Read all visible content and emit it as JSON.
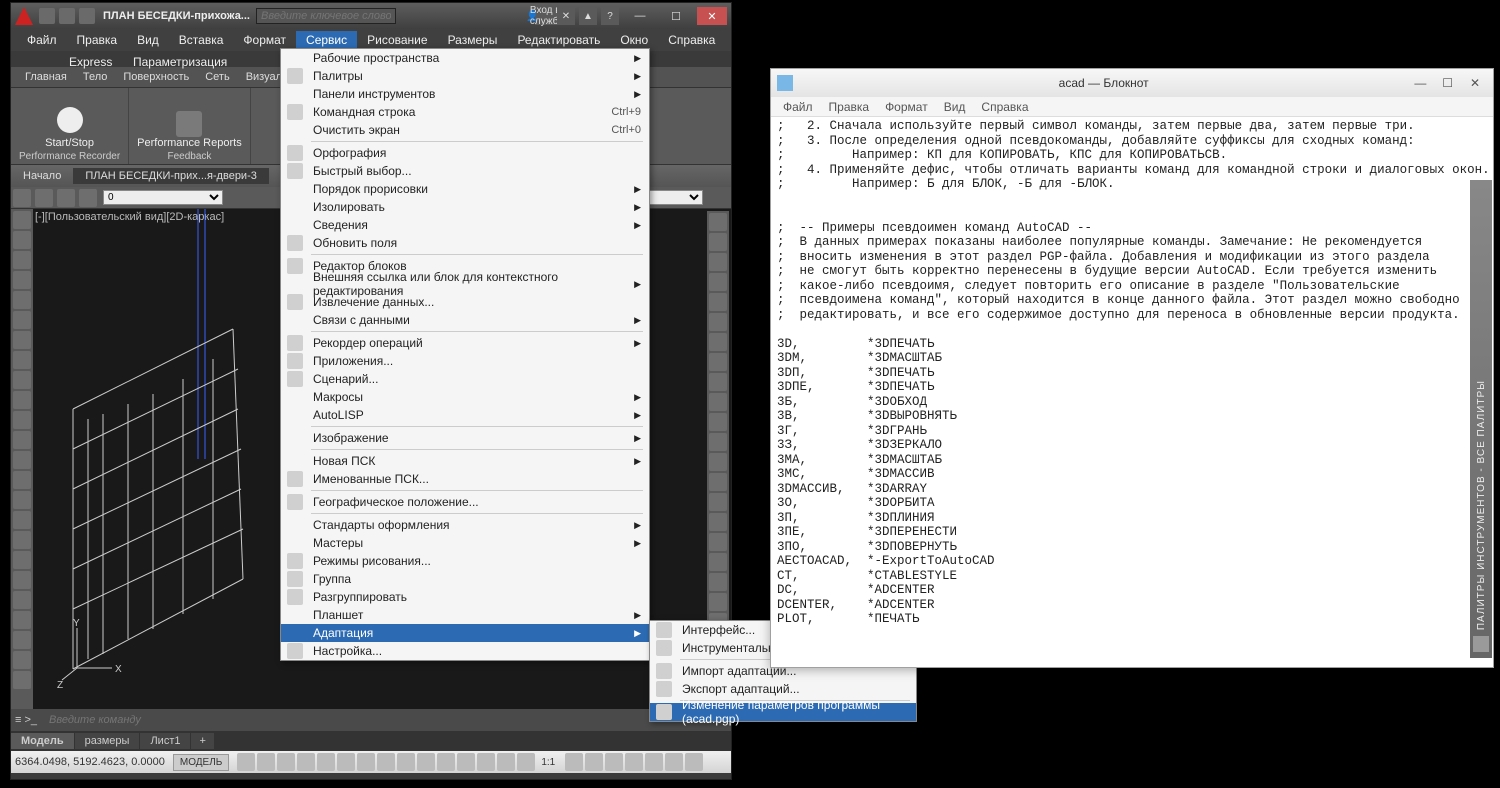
{
  "acad": {
    "doc_title": "ПЛАН БЕСЕДКИ-прихожа...",
    "search_placeholder": "Введите ключевое слово/фразу",
    "login_label": "Вход в службы",
    "menu": [
      "Файл",
      "Правка",
      "Вид",
      "Вставка",
      "Формат",
      "Сервис",
      "Рисование",
      "Размеры",
      "Редактировать",
      "Окно",
      "Справка"
    ],
    "menu_active": "Сервис",
    "express": "Express",
    "param": "Параметризация",
    "ribbon_tabs": [
      "Главная",
      "Тело",
      "Поверхность",
      "Сеть",
      "Визуализаци..."
    ],
    "ribbon": {
      "startstop": "Start/Stop",
      "perfreports": "Performance Reports",
      "panel1": "Performance Recorder",
      "panel2": "Feedback"
    },
    "start_tab": "Начало",
    "draw_tab": "ПЛАН БЕСЕДКИ-прих...я-двери-3",
    "canvas_label": "[-][Пользовательский вид][2D-каркас]",
    "cmd_placeholder": "Введите команду",
    "model_tabs": [
      "Модель",
      "размеры",
      "Лист1"
    ],
    "coords": "6364.0498, 5192.4623, 0.0000",
    "model_btn": "МОДЕЛЬ",
    "scale": "1:1"
  },
  "dropdown": [
    {
      "label": "Рабочие пространства",
      "sub": true
    },
    {
      "label": "Палитры",
      "sub": true,
      "icon": true
    },
    {
      "label": "Панели инструментов",
      "sub": true
    },
    {
      "label": "Командная строка",
      "shortcut": "Ctrl+9",
      "icon": true
    },
    {
      "label": "Очистить экран",
      "shortcut": "Ctrl+0"
    },
    "-",
    {
      "label": "Орфография",
      "icon": true
    },
    {
      "label": "Быстрый выбор...",
      "icon": true
    },
    {
      "label": "Порядок прорисовки",
      "sub": true
    },
    {
      "label": "Изолировать",
      "sub": true
    },
    {
      "label": "Сведения",
      "sub": true
    },
    {
      "label": "Обновить поля",
      "icon": true
    },
    "-",
    {
      "label": "Редактор блоков",
      "icon": true
    },
    {
      "label": "Внешняя ссылка или блок для контекстного редактирования",
      "sub": true
    },
    {
      "label": "Извлечение данных...",
      "icon": true
    },
    {
      "label": "Связи с данными",
      "sub": true
    },
    "-",
    {
      "label": "Рекордер операций",
      "sub": true,
      "icon": true
    },
    {
      "label": "Приложения...",
      "icon": true
    },
    {
      "label": "Сценарий...",
      "icon": true
    },
    {
      "label": "Макросы",
      "sub": true
    },
    {
      "label": "AutoLISP",
      "sub": true
    },
    "-",
    {
      "label": "Изображение",
      "sub": true
    },
    "-",
    {
      "label": "Новая ПСК",
      "sub": true
    },
    {
      "label": "Именованные ПСК...",
      "icon": true
    },
    "-",
    {
      "label": "Географическое положение...",
      "icon": true
    },
    "-",
    {
      "label": "Стандарты оформления",
      "sub": true
    },
    {
      "label": "Мастеры",
      "sub": true
    },
    {
      "label": "Режимы рисования...",
      "icon": true
    },
    {
      "label": "Группа",
      "icon": true
    },
    {
      "label": "Разгруппировать",
      "icon": true
    },
    {
      "label": "Планшет",
      "sub": true
    },
    {
      "label": "Адаптация",
      "sub": true,
      "sel": true
    },
    {
      "label": "Настройка...",
      "icon": true
    }
  ],
  "submenu": [
    {
      "label": "Интерфейс...",
      "icon": true
    },
    {
      "label": "Инструментальные палитры...",
      "icon": true
    },
    "-",
    {
      "label": "Импорт адаптаций...",
      "icon": true
    },
    {
      "label": "Экспорт адаптаций...",
      "icon": true
    },
    "-",
    {
      "label": "Изменение параметров программы (acad.pgp)",
      "icon": true,
      "sel": true
    }
  ],
  "notepad": {
    "title": "acad — Блокнот",
    "menu": [
      "Файл",
      "Правка",
      "Формат",
      "Вид",
      "Справка"
    ],
    "body": ";   2. Сначала используйте первый символ команды, затем первые два, затем первые три.\n;   3. После определения одной псевдокоманды, добавляйте суффиксы для сходных команд:\n;         Например: КП для КОПИРОВАТЬ, КПС для КОПИРОВАТЬСВ.\n;   4. Применяйте дефис, чтобы отличать варианты команд для командной строки и диалоговых окон.\n;         Например: Б для БЛОК, -Б для -БЛОК.\n\n\n;  -- Примеры псевдоимен команд AutoCAD --\n;  В данных примерах показаны наиболее популярные команды. Замечание: Не рекомендуется\n;  вносить изменения в этот раздел PGP-файла. Добавления и модификации из этого раздела\n;  не смогут быть корректно перенесены в будущие версии AutoCAD. Если требуется изменить\n;  какое-либо псевдоимя, следует повторить его описание в разделе \"Пользовательские\n;  псевдоимена команд\", который находится в конце данного файла. Этот раздел можно свободно\n;  редактировать, и все его содержимое доступно для переноса в обновленные версии продукта.\n\n3D,         *3DПЕЧАТЬ\n3DM,        *3DМАСШТАБ\n3DП,        *3DПЕЧАТЬ\n3DПЕ,       *3DПЕЧАТЬ\n3Б,         *3DОБХОД\n3В,         *3DВЫРОВНЯТЬ\n3Г,         *3DГРАНЬ\n3З,         *3DЗЕРКАЛО\n3МА,        *3DМАСШТАБ\n3МС,        *3DМАССИВ\n3DМАССИВ,   *3DARRAY\n3О,         *3DОРБИТА\n3П,         *3DПЛИНИЯ\n3ПЕ,        *3DПЕРЕНЕСТИ\n3ПО,        *3DПОВЕРНУТЬ\nAECTOACAD,  *-ExportToAutoCAD\nCT,         *CTABLESTYLE\nDC,         *ADCENTER\nDCENTER,    *ADCENTER\nPLOT,       *ПЕЧАТЬ"
  },
  "sidepanel_label": "ПАЛИТРЫ ИНСТРУМЕНТОВ - ВСЕ ПАЛИТРЫ"
}
